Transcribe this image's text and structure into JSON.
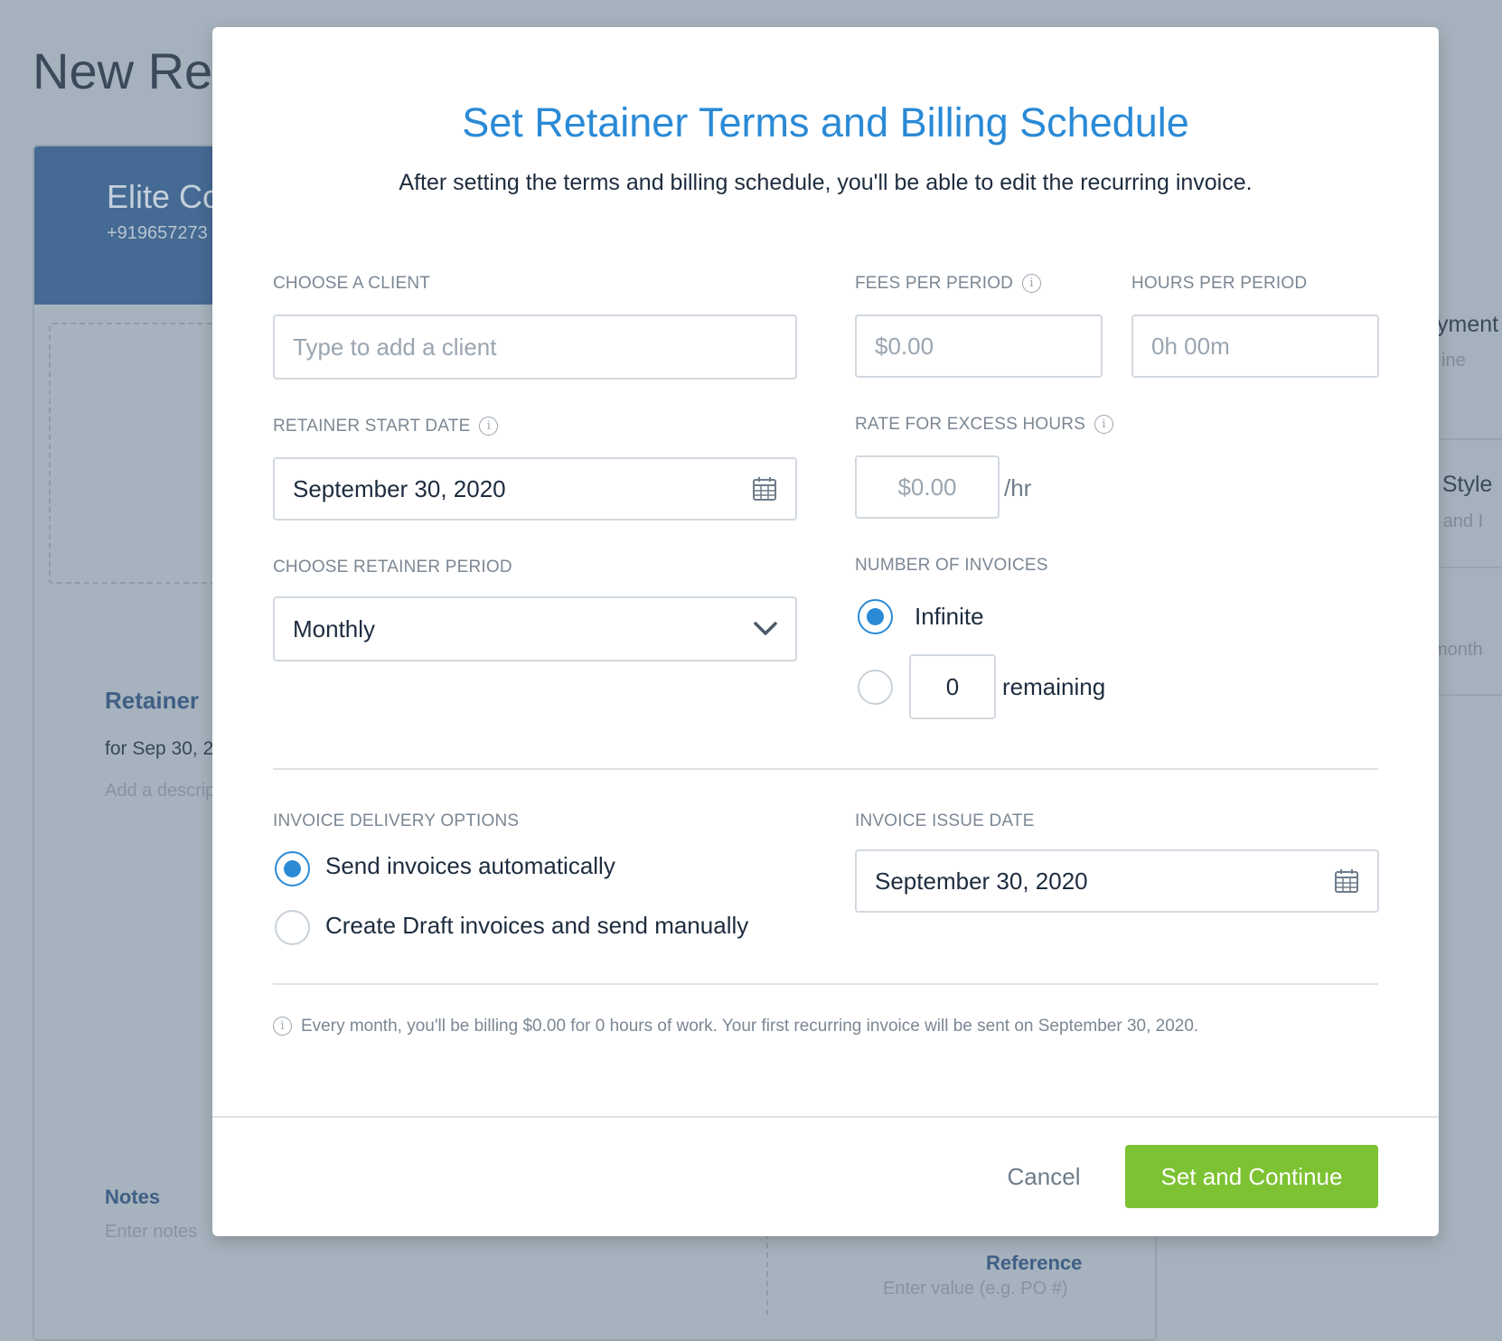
{
  "background": {
    "page_title": "New Ret",
    "client_name": "Elite Co",
    "client_phone": "+919657273",
    "retainer_heading": "Retainer",
    "retainer_for": "for Sep 30, 2",
    "add_description": "Add a descrip",
    "notes_heading": "Notes",
    "notes_placeholder": "Enter notes",
    "reference_heading": "Reference",
    "reference_placeholder": "Enter value (e.g. PO #)",
    "right_items": [
      {
        "title": "yment",
        "sub": "ine"
      },
      {
        "title": "e Style",
        "sub": "r, and I"
      },
      {
        "title": "",
        "sub": "month"
      }
    ]
  },
  "modal": {
    "title": "Set Retainer Terms and Billing Schedule",
    "subtitle": "After setting the terms and billing schedule, you'll be able to edit the recurring invoice.",
    "client": {
      "label": "CHOOSE A CLIENT",
      "placeholder": "Type to add a client"
    },
    "fees": {
      "label": "FEES PER PERIOD",
      "placeholder": "$0.00"
    },
    "hours": {
      "label": "HOURS PER PERIOD",
      "placeholder": "0h 00m"
    },
    "start_date": {
      "label": "RETAINER START DATE",
      "value": "September 30, 2020"
    },
    "excess_rate": {
      "label": "RATE FOR EXCESS HOURS",
      "placeholder": "$0.00",
      "unit": "/hr"
    },
    "period": {
      "label": "CHOOSE RETAINER PERIOD",
      "value": "Monthly"
    },
    "invoices_count": {
      "label": "NUMBER OF INVOICES",
      "infinite_label": "Infinite",
      "remaining_value": "0",
      "remaining_label": "remaining",
      "selected": "infinite"
    },
    "delivery": {
      "label": "INVOICE DELIVERY OPTIONS",
      "auto_label": "Send invoices automatically",
      "manual_label": "Create Draft invoices and send manually",
      "selected": "auto"
    },
    "issue_date": {
      "label": "INVOICE ISSUE DATE",
      "value": "September 30, 2020"
    },
    "summary": "Every month, you'll be billing $0.00 for 0 hours of work. Your first recurring invoice will be sent on September 30, 2020.",
    "cancel_label": "Cancel",
    "submit_label": "Set and Continue"
  },
  "colors": {
    "accent": "#2a8ad6",
    "primary_button": "#7dc232",
    "overlay": "#a5b1bc"
  },
  "icons": [
    "info-icon",
    "calendar-icon",
    "chevron-down-icon"
  ]
}
